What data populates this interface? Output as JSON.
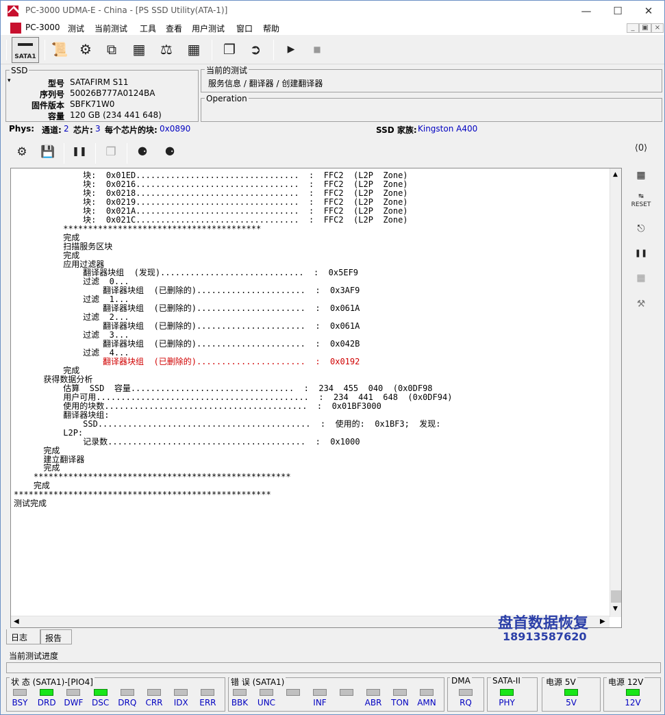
{
  "window": {
    "title": "PC-3000 UDMA-E - China - [PS SSD Utility(ATA-1)]"
  },
  "menu": [
    "PC-3000",
    "测试",
    "当前测试",
    "工具",
    "查看",
    "用户测试",
    "窗口",
    "帮助"
  ],
  "toolbar": {
    "sata_label": "SATA1"
  },
  "ssd_panel": {
    "title": "SSD",
    "fields": [
      {
        "key": "型号",
        "value": "SATAFIRM   S11"
      },
      {
        "key": "序列号",
        "value": "50026B777A0124BA"
      },
      {
        "key": "固件版本",
        "value": "SBFK71W0"
      },
      {
        "key": "容量",
        "value": "120 GB (234 441 648)"
      }
    ]
  },
  "current_test": {
    "title": "当前的测试",
    "path": "服务信息 / 翻译器 / 创建翻译器"
  },
  "operation": {
    "title": "Operation"
  },
  "phys": {
    "label": "Phys:",
    "channels_label": "通道:",
    "channels_value": "2",
    "chips_label": "芯片:",
    "chips_value": "3",
    "blocks_label": "每个芯片的块:",
    "blocks_value": "0x0890",
    "family_label": "SSD 家族:",
    "family_value": "Kingston A400"
  },
  "log": {
    "lines": [
      "              块:  0x01ED.................................  :  FFC2  (L2P  Zone)",
      "              块:  0x0216.................................  :  FFC2  (L2P  Zone)",
      "              块:  0x0218.................................  :  FFC2  (L2P  Zone)",
      "              块:  0x0219.................................  :  FFC2  (L2P  Zone)",
      "              块:  0x021A.................................  :  FFC2  (L2P  Zone)",
      "              块:  0x021C.................................  :  FFC2  (L2P  Zone)",
      "          ****************************************",
      "          完成",
      "",
      "          扫描服务区块",
      "          完成",
      "",
      "          应用过滤器",
      "              翻译器块组  (发现).............................  :  0x5EF9",
      "",
      "              过滤  0...",
      "                  翻译器块组  (已删除的)......................  :  0x3AF9",
      "",
      "              过滤  1...",
      "                  翻译器块组  (已删除的)......................  :  0x061A",
      "",
      "              过滤  2...",
      "                  翻译器块组  (已删除的)......................  :  0x061A",
      "",
      "              过滤  3...",
      "                  翻译器块组  (已删除的)......................  :  0x042B",
      "",
      "              过滤  4...",
      "                  翻译器块组  (已删除的)......................  :  0x0192",
      "          完成",
      "",
      "      获得数据分析",
      "          估算  SSD  容量.................................  :  234  455  040  (0x0DF98",
      "          用户可用...........................................  :  234  441  648  (0x0DF94)",
      "          使用的块数.........................................  :  0x01BF3000",
      "",
      "          翻译器块组:",
      "              SSD...........................................  :  使用的:  0x1BF3;  发现:",
      "",
      "          L2P:",
      "              记录数........................................  :  0x1000",
      "      完成",
      "",
      "      建立翻译器",
      "      完成",
      "    ****************************************************",
      "    完成",
      "****************************************************",
      "测试完成"
    ],
    "red_line_index": 28
  },
  "tabs": [
    "日志",
    "报告"
  ],
  "progress_label": "当前测试进度",
  "status_groups": {
    "state_title": "状 态 (SATA1)-[PIO4]",
    "state_leds": [
      {
        "label": "BSY",
        "on": false
      },
      {
        "label": "DRD",
        "on": true
      },
      {
        "label": "DWF",
        "on": false
      },
      {
        "label": "DSC",
        "on": true
      },
      {
        "label": "DRQ",
        "on": false
      },
      {
        "label": "CRR",
        "on": false
      },
      {
        "label": "IDX",
        "on": false
      },
      {
        "label": "ERR",
        "on": false
      }
    ],
    "error_title": "错 误 (SATA1)",
    "error_leds": [
      {
        "label": "BBK",
        "on": false
      },
      {
        "label": "UNC",
        "on": false
      },
      {
        "label": "",
        "on": false
      },
      {
        "label": "INF",
        "on": false
      },
      {
        "label": "",
        "on": false
      },
      {
        "label": "ABR",
        "on": false
      },
      {
        "label": "TON",
        "on": false
      },
      {
        "label": "AMN",
        "on": false
      }
    ],
    "dma_title": "DMA",
    "dma_led": {
      "label": "RQ",
      "on": false
    },
    "sata2_title": "SATA-II",
    "sata2_led": {
      "label": "PHY",
      "on": true
    },
    "p5_title": "电源 5V",
    "p5_led": {
      "label": "5V",
      "on": true
    },
    "p12_title": "电源 12V",
    "p12_led": {
      "label": "12V",
      "on": true
    }
  },
  "watermark": {
    "line1": "盘首数据恢复",
    "line2": "18913587620"
  },
  "colors": {
    "led_on": "#19e619",
    "led_off": "#c0c0c0",
    "value_blue": "#0000c0",
    "log_red": "#d00000"
  }
}
